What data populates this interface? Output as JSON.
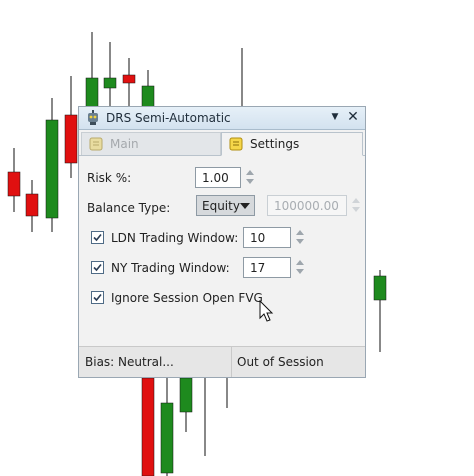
{
  "window": {
    "title": "DRS Semi-Automatic",
    "pin_icon": "pin-triangle-icon",
    "close_icon": "close-x-icon"
  },
  "tabs": [
    {
      "label": "Main",
      "icon": "scroll-icon",
      "active": false
    },
    {
      "label": "Settings",
      "icon": "scroll-icon",
      "active": true
    }
  ],
  "settings": {
    "risk_label": "Risk %:",
    "risk_value": "1.00",
    "balance_label": "Balance Type:",
    "balance_selected": "Equity",
    "balance_amount": "100000.00",
    "ldn_label": "LDN Trading Window:",
    "ldn_value": "10",
    "ldn_checked": true,
    "ny_label": "NY Trading Window:",
    "ny_value": "17",
    "ny_checked": true,
    "ignore_label": "Ignore Session Open FVG",
    "ignore_checked": true
  },
  "status": {
    "bias": "Bias: Neutral...",
    "session": "Out of Session"
  },
  "colors": {
    "bull": "#1e8a1e",
    "bear": "#e01010",
    "wick": "#111111",
    "accent": "#3a6ea5"
  },
  "chart_candles": [
    {
      "dir": "bear"
    },
    {
      "dir": "bear"
    },
    {
      "dir": "bull"
    },
    {
      "dir": "bear"
    },
    {
      "dir": "bull"
    },
    {
      "dir": "bull"
    },
    {
      "dir": "bear"
    },
    {
      "dir": "bull"
    },
    {
      "dir": "bear"
    },
    {
      "dir": "bull"
    },
    {
      "dir": "bear"
    },
    {
      "dir": "bull"
    },
    {
      "dir": "bull"
    }
  ]
}
